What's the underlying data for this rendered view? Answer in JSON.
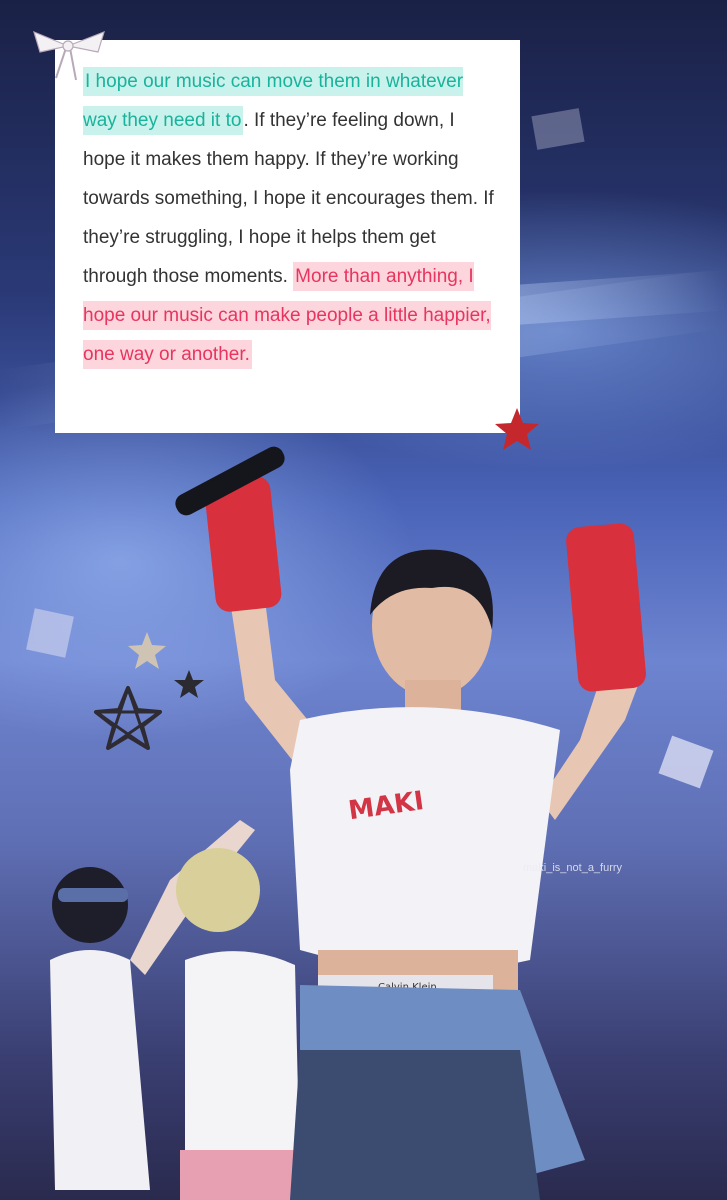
{
  "quote": {
    "part1_highlight": "I hope our music can move them in whatever way they need it to",
    "part2_plain": ". If they’re feeling down, I hope it makes them happy. If they’re working towards something, I hope it encourages them. If they’re struggling, I hope it helps them get through those moments. ",
    "part3_highlight": "More than anything, I hope our music can make people a little happier, one way or another."
  },
  "watermark": "maki_is_not_a_furry",
  "shirt_text": "MAKI",
  "waistband_text": "Calvin Klein",
  "colors": {
    "teal_highlight_bg": "#c9f2ec",
    "teal_text": "#19b39c",
    "pink_highlight_bg": "#fcd6dc",
    "pink_text": "#e8345f"
  }
}
